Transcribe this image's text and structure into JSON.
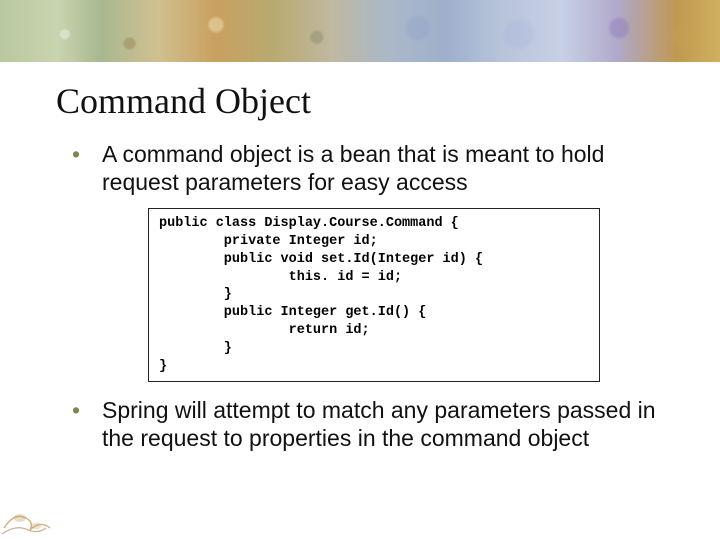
{
  "title": "Command Object",
  "bullets": [
    "A command object is a bean that is meant to hold request parameters for easy access",
    "Spring will attempt to match any parameters passed in the request to properties in the command object"
  ],
  "code": "public class Display.Course.Command {\n        private Integer id;\n        public void set.Id(Integer id) {\n                this. id = id;\n        }\n        public Integer get.Id() {\n                return id;\n        }\n}"
}
